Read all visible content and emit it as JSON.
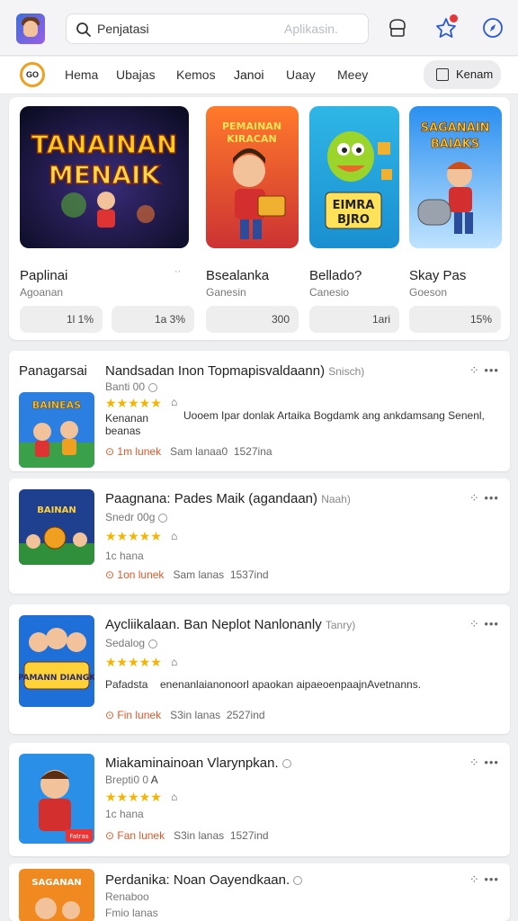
{
  "header": {
    "search_value": "Penjatasi",
    "search_placeholder": "Aplikasin.",
    "icons": [
      "app-avatar-icon",
      "search-icon",
      "store-icon",
      "star-badge-icon",
      "compass-icon"
    ]
  },
  "nav": {
    "items": [
      "Hema",
      "Ubajas",
      "Kemos",
      "Janoi",
      "Uaay",
      "Meey"
    ],
    "cta_label": "Kenam"
  },
  "featured": [
    {
      "title": "Paplinai",
      "sub": "Agoanan",
      "stat": "1l 1%",
      "dots": "··"
    },
    {
      "title": "Bsealanka",
      "sub": "Ganesin",
      "stat": "1a 3%",
      "dots": ""
    },
    {
      "title": "Bellado?",
      "sub": "Canesio",
      "stat": "300",
      "dots": ""
    },
    {
      "title": "Skay Pas",
      "sub": "Goeson",
      "stat": "1ari",
      "dots": ""
    },
    {
      "title": "",
      "sub": "",
      "stat": "15%",
      "dots": ""
    }
  ],
  "featured_art": [
    {
      "line1": "TANAINAN",
      "line2": "MENAIK"
    },
    {
      "line1": "PEMAINAN",
      "line2": "KIRACAN"
    },
    {
      "line1": "EIMRA",
      "line2": "BJRO"
    },
    {
      "line1": "SAGANAIN",
      "line2": "BAIAKS"
    }
  ],
  "list": [
    {
      "lead": "Panagarsai",
      "title": "Nandsadan Inon Topmapisvaldaann)",
      "title_extra": "Snisch)",
      "sub": "Banti 00",
      "stars": "★★★★★",
      "desc_left": "Kenanan",
      "desc_left2": "beanas",
      "desc": "Uooem Ipar donlak Artaika Bogdamk ang ankdamsang Senenl,",
      "meta_a": "1m lunek",
      "meta_b": "Sam lanaa0",
      "meta_c": "1527ina",
      "thumb_text": "BAINEAS"
    },
    {
      "lead": "",
      "title": "Paagnana: Pades Maik (agandaan)",
      "title_extra": "Naah)",
      "sub": "Snedr 00g",
      "stars": "★★★★★",
      "desc_left": "1c hana",
      "desc_left2": "",
      "desc": "",
      "meta_a": "1on lunek",
      "meta_b": "Sam lanas",
      "meta_c": "1537ind",
      "thumb_text": "BAINAN"
    },
    {
      "lead": "",
      "title": "Aycliikalaan. Ban Neplot Nanlonanly",
      "title_extra": "Tanry)",
      "sub": "Sedalog",
      "stars": "★★★★★",
      "desc_left": "Pafadsta",
      "desc_left2": "",
      "desc": "enenanlaianonoorl apaokan aipaeoenpaajnAvetnanns.",
      "meta_a": "Fin lunek",
      "meta_b": "S3in lanas",
      "meta_c": "2527ind",
      "thumb_text": "PAMANN DIANGK"
    },
    {
      "lead": "",
      "title": "Miakaminainoan Vlarynpkan.",
      "title_extra": "",
      "sub": "Brepti0 0",
      "stars": "★★★★★",
      "desc_left": "1c hana",
      "desc_left2": "",
      "desc": "",
      "meta_a": "Fan lunek",
      "meta_b": "S3in lanas",
      "meta_c": "1527ind",
      "thumb_text": "Fatras"
    },
    {
      "lead": "",
      "title": "Perdanika: Noan Oayendkaan.",
      "title_extra": "",
      "sub": "Renaboo",
      "stars": "",
      "desc_left": "Fmio lanas",
      "desc_left2": "",
      "desc": "",
      "meta_a": "",
      "meta_b": "",
      "meta_c": "",
      "thumb_text": "SAGANAN"
    }
  ]
}
